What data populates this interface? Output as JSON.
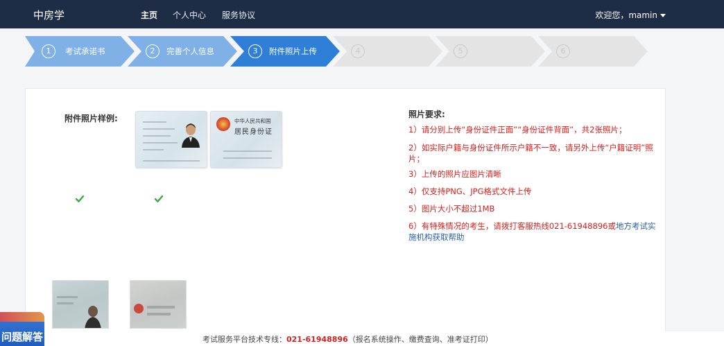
{
  "nav": {
    "brand": "中房学",
    "items": [
      {
        "label": "主页",
        "active": true
      },
      {
        "label": "个人中心",
        "active": false
      },
      {
        "label": "服务协议",
        "active": false
      }
    ],
    "user": "欢迎您，mamin"
  },
  "steps": [
    {
      "num": "1",
      "label": "考试承诺书",
      "state": "done"
    },
    {
      "num": "2",
      "label": "完善个人信息",
      "state": "done"
    },
    {
      "num": "3",
      "label": "附件照片上传",
      "state": "current"
    },
    {
      "num": "4",
      "label": "",
      "state": "pending"
    },
    {
      "num": "5",
      "label": "",
      "state": "pending"
    },
    {
      "num": "6",
      "label": "",
      "state": "pending"
    }
  ],
  "sample": {
    "label": "附件照片样例:",
    "card_back_top": "中华人民共和国",
    "card_back_title": "居民身份证"
  },
  "requirements": {
    "title": "照片要求:",
    "items": [
      "1）请分别上传“身份证件正面”“身份证件背面”，共2张照片；",
      "2）如实际户籍与身份证件所示户籍不一致，请另外上传“户籍证明”照片；",
      "3）上传的照片应图片清晰",
      "4）仅支持PNG、JPG格式文件上传",
      "5）图片大小不超过1MB"
    ],
    "item6_red": "6）有特殊情况的考生，请拨打客服热线021-61948896或",
    "item6_blue": "地方考试实施机构获取帮助"
  },
  "uploads": [
    {
      "name": "uploaded-photo-1",
      "checked": true
    },
    {
      "name": "uploaded-photo-2",
      "checked": true
    }
  ],
  "footer": {
    "prefix": "考试服务平台技术专线：",
    "phone": "021-61948896",
    "suffix": "（报名系统操作、缴费查询、准考证打印）"
  },
  "help_badge": "问题解答",
  "colors": {
    "navbar": "#1e2c45",
    "step_done": "#7fb0e6",
    "step_current": "#2f7fd8",
    "step_pending": "#e4e4e4",
    "required_text": "#d9201d",
    "link_text": "#2a5fa8"
  }
}
